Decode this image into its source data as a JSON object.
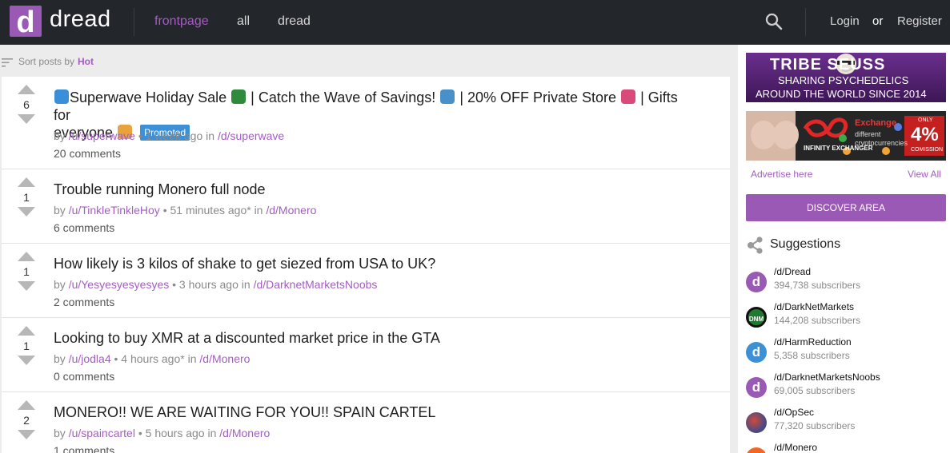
{
  "header": {
    "logo_letter": "d",
    "brand": "dread",
    "nav": [
      {
        "label": "frontpage",
        "active": true
      },
      {
        "label": "all",
        "active": false
      },
      {
        "label": "dread",
        "active": false
      }
    ],
    "search_icon": "search-icon",
    "login": "Login",
    "or": "or",
    "register": "Register"
  },
  "sort": {
    "label": "Sort posts by",
    "value": "Hot"
  },
  "posts": [
    {
      "score": "6",
      "title_part1": "Superwave Holiday Sale",
      "title_part2": "| Catch the Wave of Savings!",
      "title_part3": "| 20% OFF Private Store",
      "title_part4": "| Gifts for",
      "title_part5": "everyone",
      "promoted": "Promoted",
      "by": "by",
      "user": "/u/superwave",
      "time": "• 1 week ago in",
      "sub": "/d/superwave",
      "comments": "20 comments"
    },
    {
      "score": "1",
      "title": "Trouble running Monero full node",
      "by": "by",
      "user": "/u/TinkleTinkleHoy",
      "time": "• 51 minutes ago* in",
      "sub": "/d/Monero",
      "comments": "6 comments"
    },
    {
      "score": "1",
      "title": "How likely is 3 kilos of shake to get siezed from USA to UK?",
      "by": "by",
      "user": "/u/Yesyesyesyesyes",
      "time": "• 3 hours ago in",
      "sub": "/d/DarknetMarketsNoobs",
      "comments": "2 comments"
    },
    {
      "score": "1",
      "title": "Looking to buy XMR at a discounted market price in the GTA",
      "by": "by",
      "user": "/u/jodla4",
      "time": "• 4 hours ago* in",
      "sub": "/d/Monero",
      "comments": "0 comments"
    },
    {
      "score": "2",
      "title": "MONERO!! WE ARE WAITING FOR YOU!! SPAIN CARTEL",
      "by": "by",
      "user": "/u/spaincartel",
      "time": "• 5 hours ago in",
      "sub": "/d/Monero",
      "comments": "1 comments"
    }
  ],
  "sidebar": {
    "ad1": {
      "line1": "TRIBE SEUSS",
      "line2": "SHARING PSYCHEDELICS",
      "line3": "AROUND THE WORLD SINCE 2014"
    },
    "ad2": {
      "brand": "INFINITY EXCHANGER",
      "exchange": "Exchange",
      "different": "different",
      "crypto": "cryptocurrencies",
      "only": "ONLY",
      "pct": "4%",
      "comission": "COMISSION"
    },
    "advertise": "Advertise here",
    "view_all": "View All",
    "discover": "DISCOVER AREA",
    "suggestions_title": "Suggestions",
    "suggestions": [
      {
        "name": "/d/Dread",
        "subs": "394,738 subscribers",
        "avatar": "d",
        "color": "#9b59b6"
      },
      {
        "name": "/d/DarkNetMarkets",
        "subs": "144,208 subscribers",
        "avatar": "DNM",
        "color": "#1e7a2e"
      },
      {
        "name": "/d/HarmReduction",
        "subs": "5,358 subscribers",
        "avatar": "d",
        "color": "#3d8fd6"
      },
      {
        "name": "/d/DarknetMarketsNoobs",
        "subs": "69,005 subscribers",
        "avatar": "d",
        "color": "#9b59b6"
      },
      {
        "name": "/d/OpSec",
        "subs": "77,320 subscribers",
        "avatar": "",
        "color": "#3b4a8c"
      },
      {
        "name": "/d/Monero",
        "subs": "",
        "avatar": "",
        "color": "#f26822"
      }
    ]
  },
  "colors": {
    "accent": "#9b59b6",
    "link": "#a35ec0",
    "header_bg": "#23262b",
    "promoted": "#3d8fd6"
  }
}
